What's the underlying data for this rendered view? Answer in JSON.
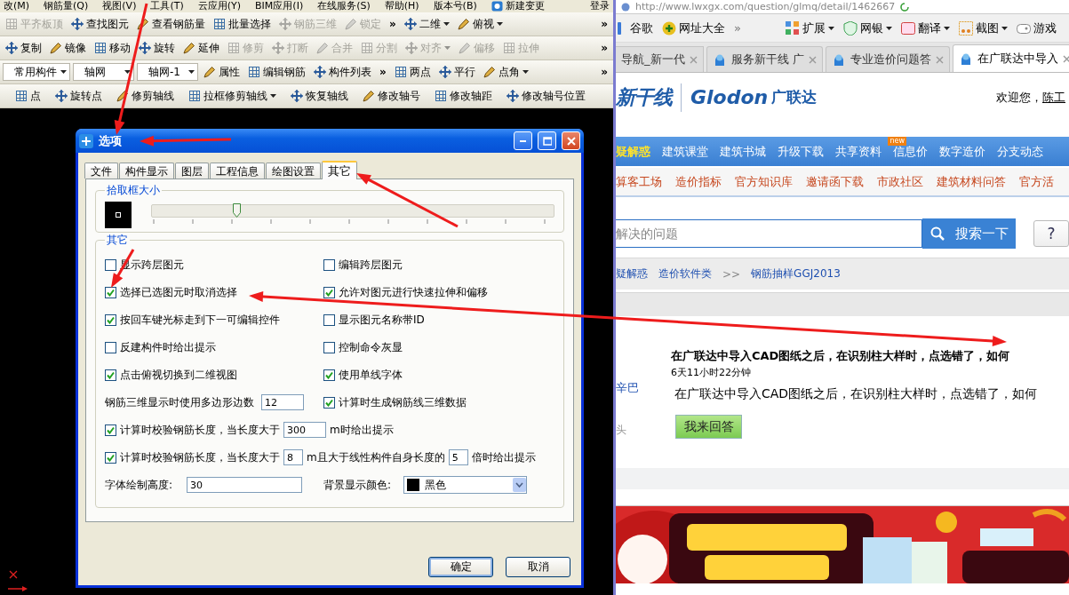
{
  "cad_app": {
    "menu_bar": [
      {
        "kind": "menu",
        "label": "改(M)"
      },
      {
        "kind": "menu",
        "label": "钢筋量(Q)"
      },
      {
        "kind": "menu",
        "label": "视图(V)"
      },
      {
        "kind": "menu",
        "label": "工具(T)"
      },
      {
        "kind": "menu",
        "label": "云应用(Y)"
      },
      {
        "kind": "menu",
        "label": "BIM应用(I)"
      },
      {
        "kind": "menu",
        "label": "在线服务(S)"
      },
      {
        "kind": "menu",
        "label": "帮助(H)"
      },
      {
        "kind": "menu",
        "label": "版本号(B)"
      },
      {
        "kind": "action",
        "label": "新建变更"
      },
      {
        "kind": "login",
        "label": "登录"
      }
    ],
    "toolbars": [
      [
        {
          "kind": "button",
          "label": "平齐板顶",
          "disabled": true
        },
        {
          "kind": "button",
          "label": "查找图元",
          "disabled": false
        },
        {
          "kind": "button",
          "label": "查看钢筋量",
          "disabled": false
        },
        {
          "kind": "button",
          "label": "批量选择",
          "disabled": false
        },
        {
          "kind": "button",
          "label": "钢筋三维",
          "disabled": true
        },
        {
          "kind": "button",
          "label": "锁定",
          "disabled": true
        },
        {
          "kind": "overflow",
          "label": "»"
        },
        {
          "kind": "dropdown",
          "label": "二维",
          "disabled": false
        },
        {
          "kind": "dropdown",
          "label": "俯视",
          "disabled": false
        },
        {
          "kind": "overflow",
          "label": "»"
        }
      ],
      [
        {
          "kind": "button",
          "label": "复制",
          "disabled": false
        },
        {
          "kind": "button",
          "label": "镜像",
          "disabled": false
        },
        {
          "kind": "button",
          "label": "移动",
          "disabled": false
        },
        {
          "kind": "button",
          "label": "旋转",
          "disabled": false
        },
        {
          "kind": "button",
          "label": "延伸",
          "disabled": false
        },
        {
          "kind": "button",
          "label": "修剪",
          "disabled": true
        },
        {
          "kind": "button",
          "label": "打断",
          "disabled": true
        },
        {
          "kind": "button",
          "label": "合并",
          "disabled": true
        },
        {
          "kind": "button",
          "label": "分割",
          "disabled": true
        },
        {
          "kind": "dropdown",
          "label": "对齐",
          "disabled": true
        },
        {
          "kind": "button",
          "label": "偏移",
          "disabled": true
        },
        {
          "kind": "button",
          "label": "拉伸",
          "disabled": true
        },
        {
          "kind": "overflow",
          "label": "»"
        }
      ],
      [
        {
          "kind": "combo",
          "label": "常用构件"
        },
        {
          "kind": "combo",
          "label": "轴网"
        },
        {
          "kind": "combo",
          "label": "轴网-1"
        },
        {
          "kind": "button",
          "label": "属性",
          "disabled": false
        },
        {
          "kind": "button",
          "label": "编辑钢筋",
          "disabled": false
        },
        {
          "kind": "button",
          "label": "构件列表",
          "disabled": false
        },
        {
          "kind": "overflow",
          "label": "»"
        },
        {
          "kind": "button",
          "label": "两点",
          "disabled": false
        },
        {
          "kind": "button",
          "label": "平行",
          "disabled": false
        },
        {
          "kind": "dropdown",
          "label": "点角",
          "disabled": false
        },
        {
          "kind": "overflow",
          "label": "»"
        }
      ],
      [
        {
          "kind": "button",
          "label": "点",
          "disabled": false
        },
        {
          "kind": "button",
          "label": "旋转点",
          "disabled": false
        },
        {
          "kind": "button",
          "label": "修剪轴线",
          "disabled": false
        },
        {
          "kind": "dropdown",
          "label": "拉框修剪轴线",
          "disabled": false
        },
        {
          "kind": "button",
          "label": "恢复轴线",
          "disabled": false
        },
        {
          "kind": "button",
          "label": "修改轴号",
          "disabled": false
        },
        {
          "kind": "button",
          "label": "修改轴距",
          "disabled": false
        },
        {
          "kind": "button",
          "label": "修改轴号位置",
          "disabled": false
        }
      ]
    ]
  },
  "dialog": {
    "title": "选项",
    "tabs": [
      {
        "label": "文件",
        "selected": false
      },
      {
        "label": "构件显示",
        "selected": false
      },
      {
        "label": "图层",
        "selected": false
      },
      {
        "label": "工程信息",
        "selected": false
      },
      {
        "label": "绘图设置",
        "selected": false
      },
      {
        "label": "其它",
        "selected": true
      }
    ],
    "pick_box": {
      "title": "拾取框大小",
      "level": 0.21
    },
    "other": {
      "title": "其它",
      "rows": [
        {
          "kind": "pair",
          "cells": [
            {
              "kind": "check",
              "label": "显示跨层图元",
              "checked": false
            },
            {
              "kind": "check",
              "label": "编辑跨层图元",
              "checked": false
            }
          ]
        },
        {
          "kind": "pair",
          "cells": [
            {
              "kind": "check",
              "label": "选择已选图元时取消选择",
              "checked": true
            },
            {
              "kind": "check",
              "label": "允许对图元进行快速拉伸和偏移",
              "checked": true
            }
          ]
        },
        {
          "kind": "pair",
          "cells": [
            {
              "kind": "check",
              "label": "按回车键光标走到下一可编辑控件",
              "checked": true
            },
            {
              "kind": "check",
              "label": "显示图元名称带ID",
              "checked": false
            }
          ]
        },
        {
          "kind": "pair",
          "cells": [
            {
              "kind": "check",
              "label": "反建构件时给出提示",
              "checked": false
            },
            {
              "kind": "check",
              "label": "控制命令灰显",
              "checked": false
            }
          ]
        },
        {
          "kind": "pair",
          "cells": [
            {
              "kind": "check",
              "label": "点击俯视切换到二维视图",
              "checked": true
            },
            {
              "kind": "check",
              "label": "使用单线字体",
              "checked": true
            }
          ]
        },
        {
          "kind": "pair",
          "cells": [
            {
              "kind": "number",
              "label": "钢筋三维显示时使用多边形边数",
              "value": "12"
            },
            {
              "kind": "check",
              "label": "计算时生成钢筋线三维数据",
              "checked": true
            }
          ]
        },
        {
          "kind": "wide",
          "checked": true,
          "parts": [
            {
              "kind": "text",
              "text": "计算时校验钢筋长度，当长度大于"
            },
            {
              "kind": "field",
              "value": "300"
            },
            {
              "kind": "text",
              "text": "m时给出提示"
            }
          ]
        },
        {
          "kind": "wide",
          "checked": true,
          "parts": [
            {
              "kind": "text",
              "text": "计算时校验钢筋长度，当长度大于"
            },
            {
              "kind": "field",
              "value": "8"
            },
            {
              "kind": "text",
              "text": "m且大于线性构件自身长度的"
            },
            {
              "kind": "field",
              "value": "5"
            },
            {
              "kind": "text",
              "text": "倍时给出提示"
            }
          ]
        },
        {
          "kind": "pair",
          "cells": [
            {
              "kind": "text_field",
              "label": "字体绘制高度:",
              "value": "30"
            },
            {
              "kind": "color_select",
              "label": "背景显示颜色:",
              "value": "黑色",
              "color": "#000000"
            }
          ]
        }
      ]
    },
    "buttons": [
      {
        "label": "确定",
        "default": true
      },
      {
        "label": "取消",
        "default": false
      }
    ]
  },
  "browser": {
    "address": "http://www.lwxgx.com/question/glmq/detail/1462667",
    "bookmarks": [
      {
        "kind": "link",
        "label": "谷歌"
      },
      {
        "kind": "link",
        "label": "网址大全"
      },
      {
        "kind": "overflow",
        "label": "»"
      },
      {
        "kind": "tool",
        "label": "扩展"
      },
      {
        "kind": "tool",
        "label": "网银"
      },
      {
        "kind": "tool",
        "label": "翻译"
      },
      {
        "kind": "tool",
        "label": "截图"
      },
      {
        "kind": "link",
        "label": "游戏"
      }
    ],
    "tabs": [
      {
        "label": "导航_新一代",
        "selected": false
      },
      {
        "label": "服务新干线 广",
        "selected": false
      },
      {
        "label": "专业造价问题答",
        "selected": false
      },
      {
        "label": "在广联达中导入",
        "selected": true
      }
    ],
    "logo": {
      "site": "新干线",
      "brand": "Glodon",
      "brand_cn": "广联达"
    },
    "welcome": "欢迎您，",
    "user": "陈工",
    "nav": [
      {
        "label": "疑解惑",
        "selected": true
      },
      {
        "label": "建筑课堂",
        "selected": false
      },
      {
        "label": "建筑书城",
        "selected": false
      },
      {
        "label": "升级下载",
        "selected": false
      },
      {
        "label": "共享资料",
        "selected": false,
        "badge": "new"
      },
      {
        "label": "信息价",
        "selected": false
      },
      {
        "label": "数字造价",
        "selected": false
      },
      {
        "label": "分支动态",
        "selected": false
      }
    ],
    "subnav": [
      "算客工场",
      "造价指标",
      "官方知识库",
      "邀请函下载",
      "市政社区",
      "建筑材料问答",
      "官方活"
    ],
    "search": {
      "placeholder": "解决的问题",
      "button": "搜索一下",
      "help": "?"
    },
    "breadcrumb": [
      {
        "kind": "link",
        "label": "疑解惑"
      },
      {
        "kind": "link",
        "label": "造价软件类"
      },
      {
        "kind": "separator",
        "label": ">>"
      },
      {
        "kind": "link",
        "label": "钢筋抽样GGJ2013"
      }
    ],
    "question": {
      "title": "在广联达中导入CAD图纸之后，在识别柱大样时，点选错了，如何",
      "time": "6天11小时22分钟",
      "body": "在广联达中导入CAD图纸之后，在识别柱大样时，点选错了，如何",
      "asker": "辛巴",
      "side_note": "头",
      "answer_button": "我来回答"
    },
    "banner": {
      "kind": "picture"
    }
  }
}
